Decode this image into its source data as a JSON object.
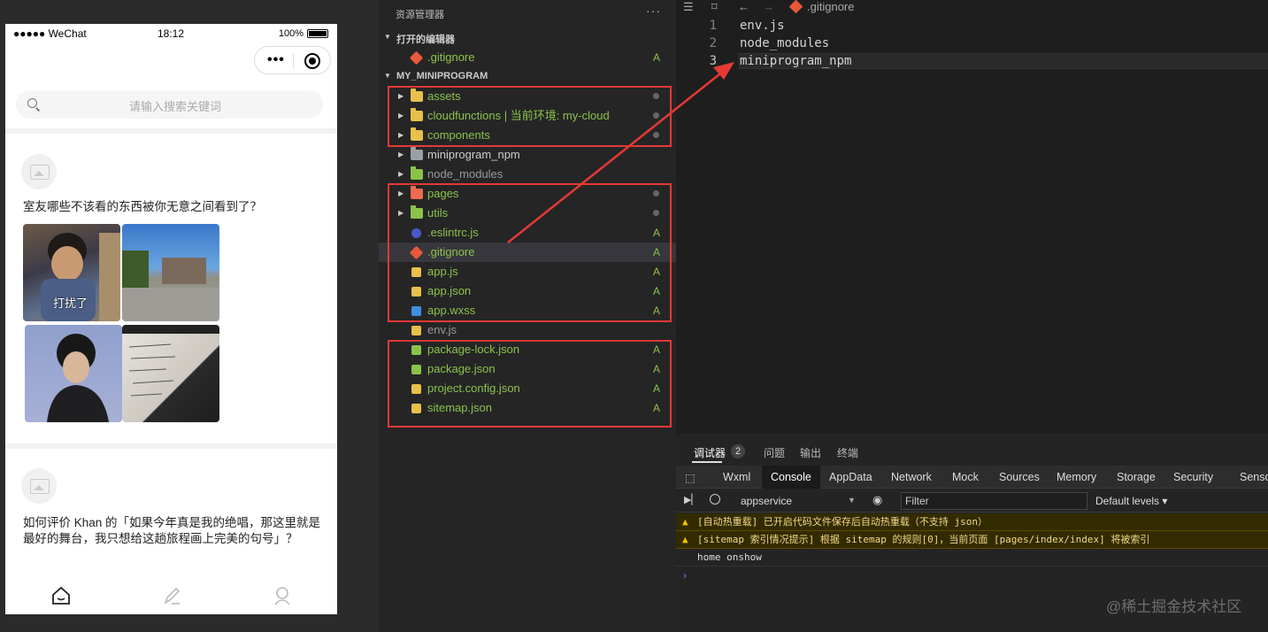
{
  "simulator": {
    "status": {
      "carrier": "●●●●● WeChat",
      "time": "18:12",
      "battery": "100%"
    },
    "search_placeholder": "请输入搜索关键词",
    "feed": [
      {
        "question": "室友哪些不该看的东西被你无意之间看到了？",
        "image_caption": "打扰了"
      },
      {
        "question": "如何评价 Khan 的「如果今年真是我的绝唱，那这里就是最好的舞台，我只想给这趟旅程画上完美的句号」？"
      }
    ]
  },
  "explorer": {
    "title": "资源管理器",
    "more": "···",
    "open_editors_label": "打开的编辑器",
    "open_editors": [
      {
        "name": ".gitignore",
        "badge": "A"
      }
    ],
    "project_label": "MY_MINIPROGRAM",
    "items": [
      {
        "name": "assets",
        "kind": "folder",
        "status": "dot",
        "color": "#e8c04a"
      },
      {
        "name": "cloudfunctions | 当前环境: my-cloud",
        "kind": "folder",
        "status": "dot",
        "color": "#e8c04a"
      },
      {
        "name": "components",
        "kind": "folder",
        "status": "dot",
        "color": "#e8c04a"
      },
      {
        "name": "miniprogram_npm",
        "kind": "folder",
        "status": "",
        "color": "#9aa0a6"
      },
      {
        "name": "node_modules",
        "kind": "folder",
        "status": "",
        "color": "#8bc34a"
      },
      {
        "name": "pages",
        "kind": "folder",
        "status": "dot",
        "color": "#ef6a51"
      },
      {
        "name": "utils",
        "kind": "folder",
        "status": "dot",
        "color": "#8bc34a"
      },
      {
        "name": ".eslintrc.js",
        "kind": "file",
        "status": "A",
        "color": "#4b57c9"
      },
      {
        "name": ".gitignore",
        "kind": "file",
        "status": "A",
        "color": "#e8583b"
      },
      {
        "name": "app.js",
        "kind": "file",
        "status": "A",
        "color": "#e8c04a"
      },
      {
        "name": "app.json",
        "kind": "file",
        "status": "A",
        "color": "#e8c04a"
      },
      {
        "name": "app.wxss",
        "kind": "file",
        "status": "A",
        "color": "#3d8fe0"
      },
      {
        "name": "env.js",
        "kind": "file",
        "status": "",
        "color": "#e8c04a"
      },
      {
        "name": "package-lock.json",
        "kind": "file",
        "status": "A",
        "color": "#8bc34a"
      },
      {
        "name": "package.json",
        "kind": "file",
        "status": "A",
        "color": "#8bc34a"
      },
      {
        "name": "project.config.json",
        "kind": "file",
        "status": "A",
        "color": "#e8c04a"
      },
      {
        "name": "sitemap.json",
        "kind": "file",
        "status": "A",
        "color": "#e8c04a"
      }
    ]
  },
  "editor": {
    "tab_name": ".gitignore",
    "lines": [
      "env.js",
      "node_modules",
      "miniprogram_npm"
    ]
  },
  "debug": {
    "tabs": [
      "调试器",
      "问题",
      "输出",
      "终端"
    ],
    "debugger_count": "2",
    "devtools_tabs": [
      "Wxml",
      "Console",
      "AppData",
      "Network",
      "Mock",
      "Sources",
      "Memory",
      "Storage",
      "Security",
      "Senso"
    ],
    "context": "appservice",
    "filter_placeholder": "Filter",
    "levels": "Default levels",
    "messages": [
      {
        "type": "warn",
        "text": "[自动热重载] 已开启代码文件保存后自动热重载（不支持 json）"
      },
      {
        "type": "warn",
        "text": "[sitemap 索引情况提示] 根据 sitemap 的规则[0]，当前页面 [pages/index/index] 将被索引"
      },
      {
        "type": "log",
        "text": "home onshow"
      }
    ],
    "watermark": "@稀土掘金技术社区"
  },
  "colors": {
    "annotation_red": "#e53935",
    "warning_yellow": "#f2c200"
  }
}
